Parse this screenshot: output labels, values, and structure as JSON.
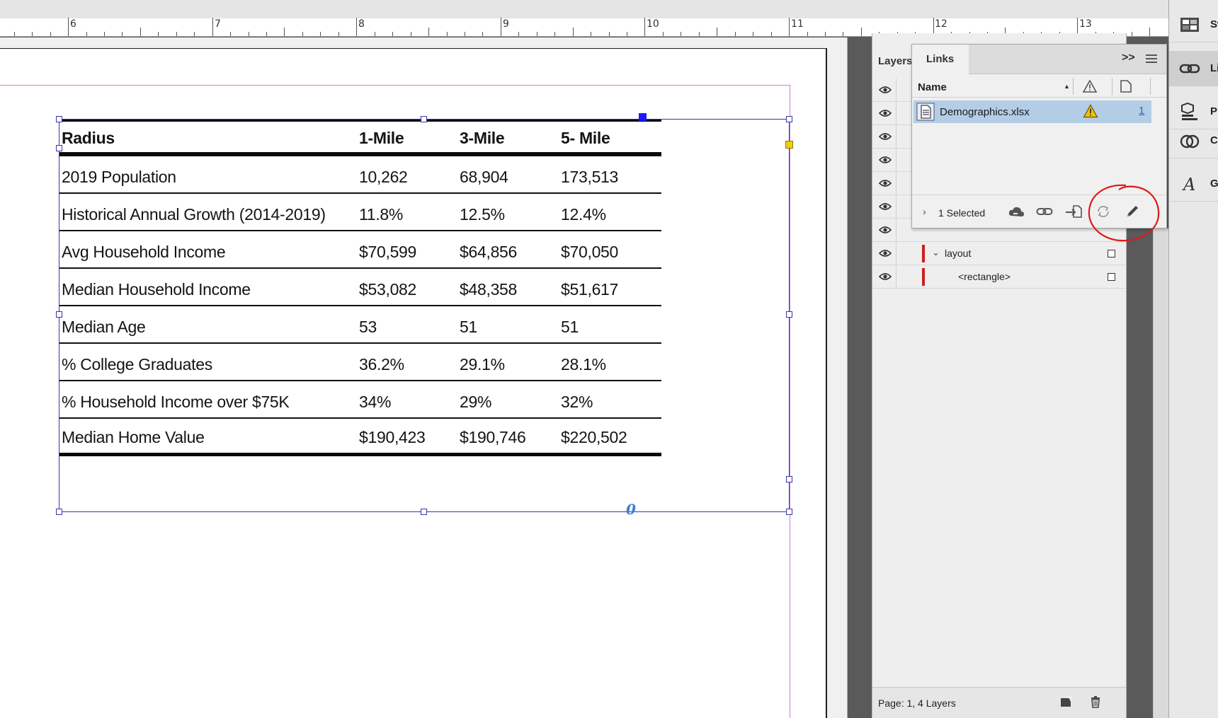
{
  "ruler": {
    "numbers": [
      "6",
      "7",
      "8",
      "9",
      "10",
      "11",
      "12",
      "13"
    ]
  },
  "table": {
    "header": [
      "Radius",
      "1-Mile",
      "3-Mile",
      "5- Mile"
    ],
    "rows": [
      [
        "2019 Population",
        "10,262",
        "68,904",
        "173,513"
      ],
      [
        "Historical Annual Growth (2014-2019)",
        "11.8%",
        "12.5%",
        "12.4%"
      ],
      [
        "Avg Household Income",
        "$70,599",
        "$64,856",
        "$70,050"
      ],
      [
        "Median Household Income",
        "$53,082",
        "$48,358",
        "$51,617"
      ],
      [
        "Median Age",
        "53",
        "51",
        "51"
      ],
      [
        "% College Graduates",
        "36.2%",
        "29.1%",
        "28.1%"
      ],
      [
        "% Household Income over $75K",
        "34%",
        "29%",
        "32%"
      ],
      [
        "Median Home Value",
        "$190,423",
        "$190,746",
        "$220,502"
      ]
    ]
  },
  "frame": {
    "overset_marker": "0"
  },
  "layers_panel": {
    "tab_label": "Layers",
    "rows": [
      {
        "name": "layout",
        "expanded": true
      },
      {
        "name": "<rectangle>",
        "expanded": false
      }
    ],
    "footer_text": "Page: 1, 4 Layers"
  },
  "links_panel": {
    "tab_label": "Links",
    "collapse_label": ">>",
    "column_name": "Name",
    "link_items": [
      {
        "name": "Demographics.xlsx",
        "status": "modified-warning",
        "page": "1"
      }
    ],
    "selected_count": "1 Selected"
  },
  "dock": {
    "items": [
      {
        "icon": "swatches-icon",
        "label": "Swatches"
      },
      {
        "icon": "links-icon",
        "label": "Links"
      },
      {
        "icon": "properties-icon",
        "label": "Properties"
      },
      {
        "icon": "cc-libraries-icon",
        "label": "CC Libraries"
      },
      {
        "icon": "glyphs-icon",
        "label": "Glyphs"
      }
    ]
  },
  "colors": {
    "selection": "#3636a8",
    "margin_guide": "#d27ad2",
    "link_selected_bg": "#b4cde6",
    "warning": "#f2c200",
    "annotation": "#e01818",
    "layer_color": "#cc1f1f"
  }
}
